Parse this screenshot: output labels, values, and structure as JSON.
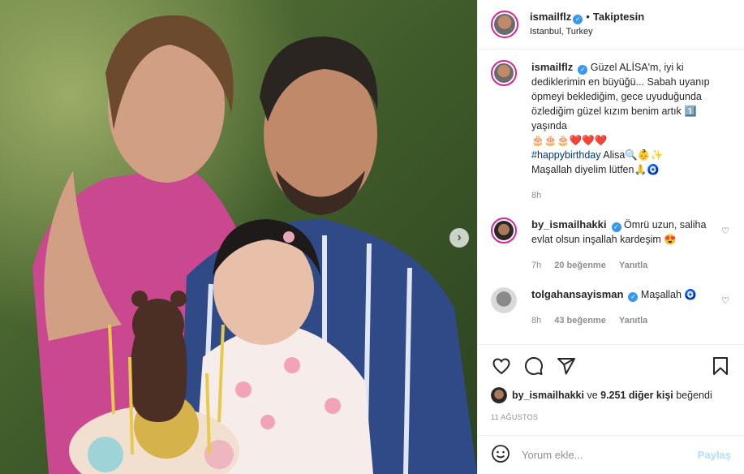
{
  "post": {
    "username": "ismailflz",
    "follow_status": "Takiptesin",
    "location": "Istanbul, Turkey",
    "caption_user": "ismailflz",
    "caption_text": "Güzel ALİSA'm, iyi ki dediklerimin en büyüğü... Sabah uyanıp öpmeyi beklediğim, gece uyuduğunda özlediğim güzel kızım benim artık 1️⃣ yaşında",
    "caption_emojis": "🎂🎂🎂❤️❤️❤️",
    "caption_hashtag": "#happybirthday",
    "caption_tail": " Alisa🔍👶✨",
    "caption_line3": "Maşallah diyelim lütfen🙏🧿",
    "caption_time": "8h"
  },
  "comments": [
    {
      "user": "by_ismailhakki",
      "text": "Ömrü uzun, saliha evlat olsun inşallah kardeşim 😍",
      "time": "7h",
      "likes": "20 beğenme",
      "reply": "Yanıtla"
    },
    {
      "user": "tolgahansayisman",
      "text": "Maşallah 🧿",
      "time": "8h",
      "likes": "43 beğenme",
      "reply": "Yanıtla"
    }
  ],
  "liked_by": {
    "user": "by_ismailhakki",
    "connector": "ve",
    "others": "9.251 diğer kişi",
    "suffix": "beğendi"
  },
  "date": "11 AĞUSTOS",
  "add_comment": {
    "placeholder": "Yorum ekle...",
    "share_label": "Paylaş"
  },
  "icons": {
    "next": "chevron-right-icon",
    "like": "heart-icon",
    "comment": "speech-bubble-icon",
    "share": "paper-plane-icon",
    "save": "bookmark-icon",
    "emoji": "smiley-icon",
    "verified": "verified-badge-icon"
  },
  "colors": {
    "verified": "#3897f0",
    "story_ring": "#d6249f",
    "share_button": "#b2dffc",
    "hashtag": "#00376b"
  }
}
